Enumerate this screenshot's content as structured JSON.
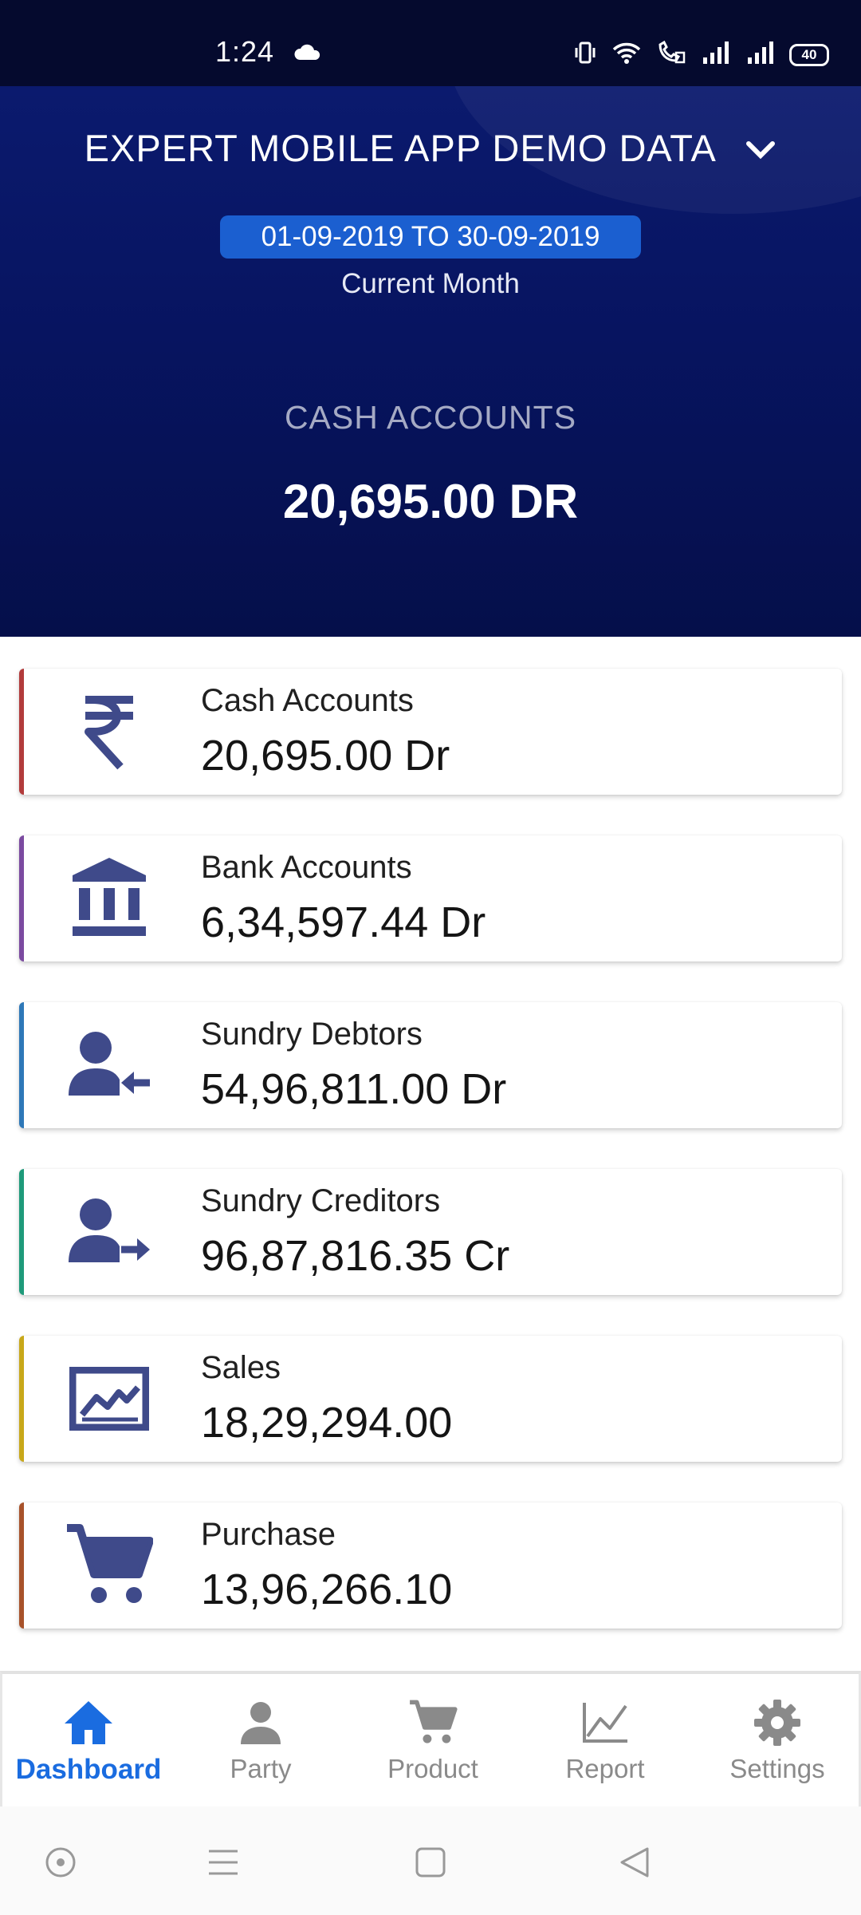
{
  "status_bar": {
    "time": "1:24",
    "battery": "40"
  },
  "header": {
    "company": "EXPERT MOBILE APP DEMO DATA",
    "date_range": "01-09-2019 TO 30-09-2019",
    "period": "Current Month",
    "summary_title": "CASH ACCOUNTS",
    "summary_value": "20,695.00 DR"
  },
  "cards": [
    {
      "label": "Cash Accounts",
      "value": "20,695.00 Dr",
      "icon": "rupee-icon",
      "accent": "#b23b3b"
    },
    {
      "label": "Bank Accounts",
      "value": "6,34,597.44 Dr",
      "icon": "bank-icon",
      "accent": "#7b4aa0"
    },
    {
      "label": "Sundry Debtors",
      "value": "54,96,811.00 Dr",
      "icon": "user-arrow-left-icon",
      "accent": "#2e78b8"
    },
    {
      "label": "Sundry Creditors",
      "value": "96,87,816.35 Cr",
      "icon": "user-arrow-right-icon",
      "accent": "#1e9a7a"
    },
    {
      "label": "Sales",
      "value": "18,29,294.00",
      "icon": "chart-icon",
      "accent": "#c8a81a"
    },
    {
      "label": "Purchase",
      "value": "13,96,266.10",
      "icon": "cart-icon",
      "accent": "#a8522a"
    }
  ],
  "nav": {
    "dashboard": "Dashboard",
    "party": "Party",
    "product": "Product",
    "report": "Report",
    "settings": "Settings"
  },
  "colors": {
    "header_bg": "#071560",
    "icon": "#3f4a8a",
    "nav_active": "#1a6ce0",
    "nav_inactive": "#8a8a8a",
    "pill": "#1b5fd0"
  }
}
